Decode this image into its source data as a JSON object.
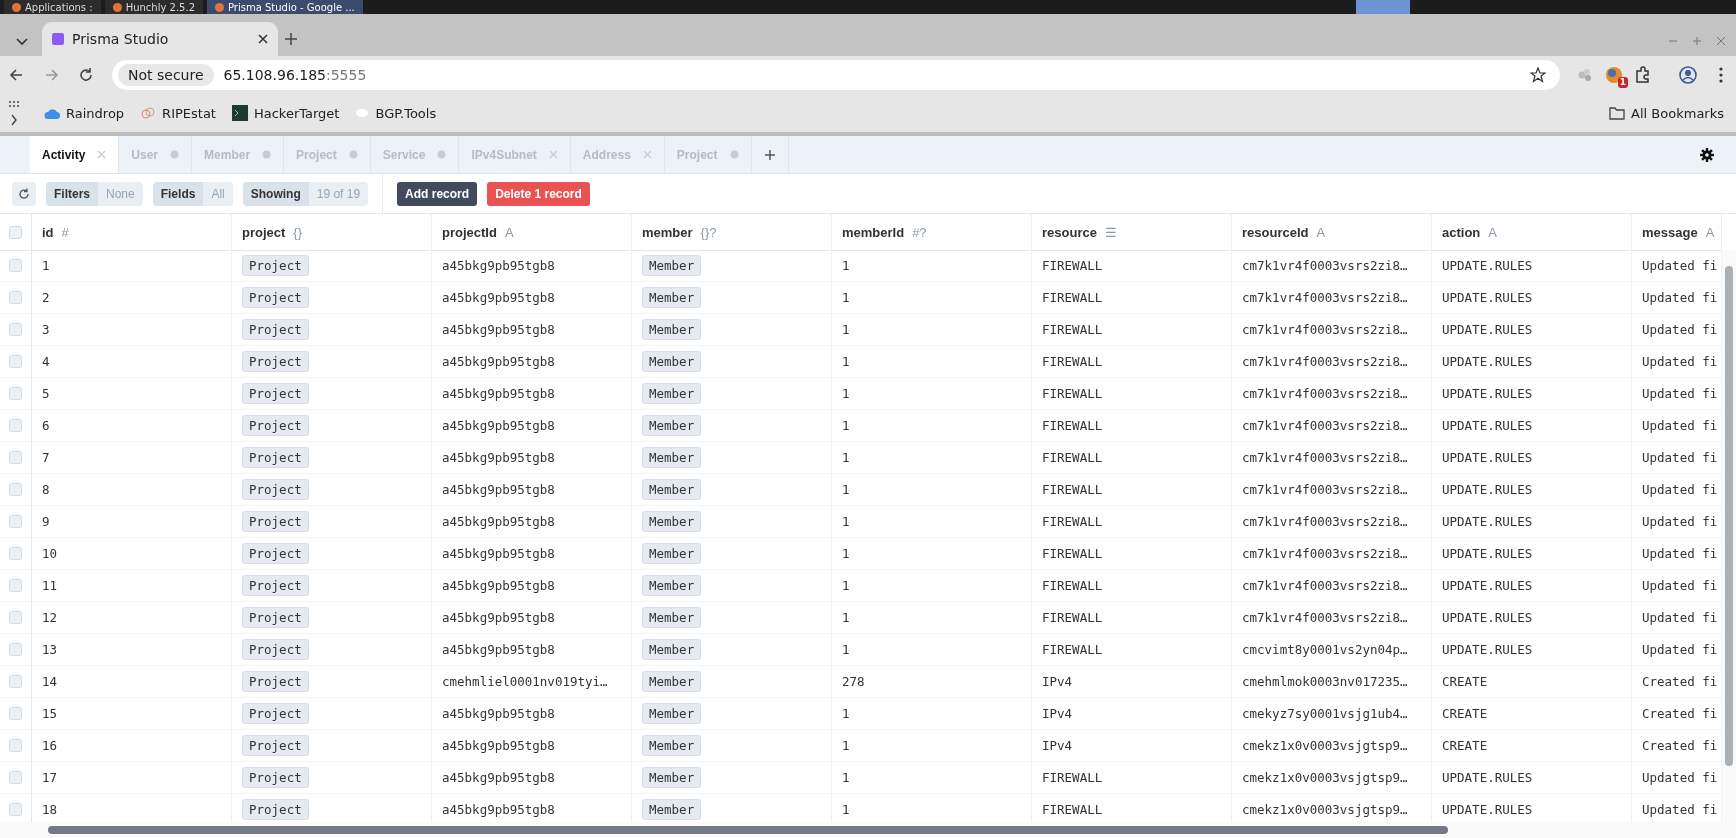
{
  "taskbar": {
    "items": [
      {
        "label": "Applications :",
        "selected": false
      },
      {
        "label": "Hunchly 2.5.2",
        "selected": false
      },
      {
        "label": "Prisma Studio - Google ...",
        "selected": true
      }
    ]
  },
  "browser": {
    "tab": {
      "title": "Prisma Studio"
    },
    "security": "Not secure",
    "url_host": "65.108.96.185",
    "url_port": ":5555",
    "extension_badge": "1",
    "bookmarks": [
      "Raindrop",
      "RIPEstat",
      "HackerTarget",
      "BGP.Tools"
    ],
    "all_bookmarks": "All Bookmarks"
  },
  "studio_tabs": [
    {
      "label": "Activity",
      "selected": true,
      "kind": "closable"
    },
    {
      "label": "User",
      "selected": false,
      "kind": "dotted"
    },
    {
      "label": "Member",
      "selected": false,
      "kind": "dotted"
    },
    {
      "label": "Project",
      "selected": false,
      "kind": "dotted"
    },
    {
      "label": "Service",
      "selected": false,
      "kind": "dotted"
    },
    {
      "label": "IPv4Subnet",
      "selected": false,
      "kind": "closable"
    },
    {
      "label": "Address",
      "selected": false,
      "kind": "closable"
    },
    {
      "label": "Project",
      "selected": false,
      "kind": "dotted"
    }
  ],
  "toolbar": {
    "filters": {
      "label": "Filters",
      "value": "None"
    },
    "fields": {
      "label": "Fields",
      "value": "All"
    },
    "showing": {
      "label": "Showing",
      "value": "19 of 19"
    },
    "add_button": "Add record",
    "delete_button": "Delete 1 record"
  },
  "table": {
    "all_checked": false,
    "columns": [
      {
        "name": "id",
        "type_icon": "#"
      },
      {
        "name": "project",
        "type_icon": "{}"
      },
      {
        "name": "projectId",
        "type_icon": "A"
      },
      {
        "name": "member",
        "type_icon": "{}?"
      },
      {
        "name": "memberId",
        "type_icon": "#?"
      },
      {
        "name": "resource",
        "type_icon": "☰"
      },
      {
        "name": "resourceId",
        "type_icon": "A"
      },
      {
        "name": "action",
        "type_icon": "A"
      },
      {
        "name": "message",
        "type_icon": "A"
      }
    ],
    "rows": [
      {
        "checked": false,
        "cells": [
          "1",
          "Project",
          "a45bkg9pb95tgb8",
          "Member",
          "1",
          "FIREWALL",
          "cm7k1vr4f0003vsrs2zi8…",
          "UPDATE.RULES",
          "Updated fi"
        ]
      },
      {
        "checked": false,
        "cells": [
          "2",
          "Project",
          "a45bkg9pb95tgb8",
          "Member",
          "1",
          "FIREWALL",
          "cm7k1vr4f0003vsrs2zi8…",
          "UPDATE.RULES",
          "Updated fi"
        ]
      },
      {
        "checked": false,
        "cells": [
          "3",
          "Project",
          "a45bkg9pb95tgb8",
          "Member",
          "1",
          "FIREWALL",
          "cm7k1vr4f0003vsrs2zi8…",
          "UPDATE.RULES",
          "Updated fi"
        ]
      },
      {
        "checked": false,
        "cells": [
          "4",
          "Project",
          "a45bkg9pb95tgb8",
          "Member",
          "1",
          "FIREWALL",
          "cm7k1vr4f0003vsrs2zi8…",
          "UPDATE.RULES",
          "Updated fi"
        ]
      },
      {
        "checked": false,
        "cells": [
          "5",
          "Project",
          "a45bkg9pb95tgb8",
          "Member",
          "1",
          "FIREWALL",
          "cm7k1vr4f0003vsrs2zi8…",
          "UPDATE.RULES",
          "Updated fi"
        ]
      },
      {
        "checked": false,
        "cells": [
          "6",
          "Project",
          "a45bkg9pb95tgb8",
          "Member",
          "1",
          "FIREWALL",
          "cm7k1vr4f0003vsrs2zi8…",
          "UPDATE.RULES",
          "Updated fi"
        ]
      },
      {
        "checked": false,
        "cells": [
          "7",
          "Project",
          "a45bkg9pb95tgb8",
          "Member",
          "1",
          "FIREWALL",
          "cm7k1vr4f0003vsrs2zi8…",
          "UPDATE.RULES",
          "Updated fi"
        ]
      },
      {
        "checked": false,
        "cells": [
          "8",
          "Project",
          "a45bkg9pb95tgb8",
          "Member",
          "1",
          "FIREWALL",
          "cm7k1vr4f0003vsrs2zi8…",
          "UPDATE.RULES",
          "Updated fi"
        ]
      },
      {
        "checked": false,
        "cells": [
          "9",
          "Project",
          "a45bkg9pb95tgb8",
          "Member",
          "1",
          "FIREWALL",
          "cm7k1vr4f0003vsrs2zi8…",
          "UPDATE.RULES",
          "Updated fi"
        ]
      },
      {
        "checked": false,
        "cells": [
          "10",
          "Project",
          "a45bkg9pb95tgb8",
          "Member",
          "1",
          "FIREWALL",
          "cm7k1vr4f0003vsrs2zi8…",
          "UPDATE.RULES",
          "Updated fi"
        ]
      },
      {
        "checked": false,
        "cells": [
          "11",
          "Project",
          "a45bkg9pb95tgb8",
          "Member",
          "1",
          "FIREWALL",
          "cm7k1vr4f0003vsrs2zi8…",
          "UPDATE.RULES",
          "Updated fi"
        ]
      },
      {
        "checked": false,
        "cells": [
          "12",
          "Project",
          "a45bkg9pb95tgb8",
          "Member",
          "1",
          "FIREWALL",
          "cm7k1vr4f0003vsrs2zi8…",
          "UPDATE.RULES",
          "Updated fi"
        ]
      },
      {
        "checked": false,
        "cells": [
          "13",
          "Project",
          "a45bkg9pb95tgb8",
          "Member",
          "1",
          "FIREWALL",
          "cmcvimt8y0001vs2yn04p…",
          "UPDATE.RULES",
          "Updated fi"
        ]
      },
      {
        "checked": false,
        "cells": [
          "14",
          "Project",
          "cmehmliel0001nv019tyi…",
          "Member",
          "278",
          "IPv4",
          "cmehmlmok0003nv017235…",
          "CREATE",
          "Created fi"
        ]
      },
      {
        "checked": false,
        "cells": [
          "15",
          "Project",
          "a45bkg9pb95tgb8",
          "Member",
          "1",
          "IPv4",
          "cmekyz7sy0001vsjg1ub4…",
          "CREATE",
          "Created fi"
        ]
      },
      {
        "checked": false,
        "cells": [
          "16",
          "Project",
          "a45bkg9pb95tgb8",
          "Member",
          "1",
          "IPv4",
          "cmekz1x0v0003vsjgtsp9…",
          "CREATE",
          "Created fi"
        ]
      },
      {
        "checked": false,
        "cells": [
          "17",
          "Project",
          "a45bkg9pb95tgb8",
          "Member",
          "1",
          "FIREWALL",
          "cmekz1x0v0003vsjgtsp9…",
          "UPDATE.RULES",
          "Updated fi"
        ]
      },
      {
        "checked": false,
        "cells": [
          "18",
          "Project",
          "a45bkg9pb95tgb8",
          "Member",
          "1",
          "FIREWALL",
          "cmekz1x0v0003vsjgtsp9…",
          "UPDATE.RULES",
          "Updated fi"
        ]
      }
    ]
  }
}
